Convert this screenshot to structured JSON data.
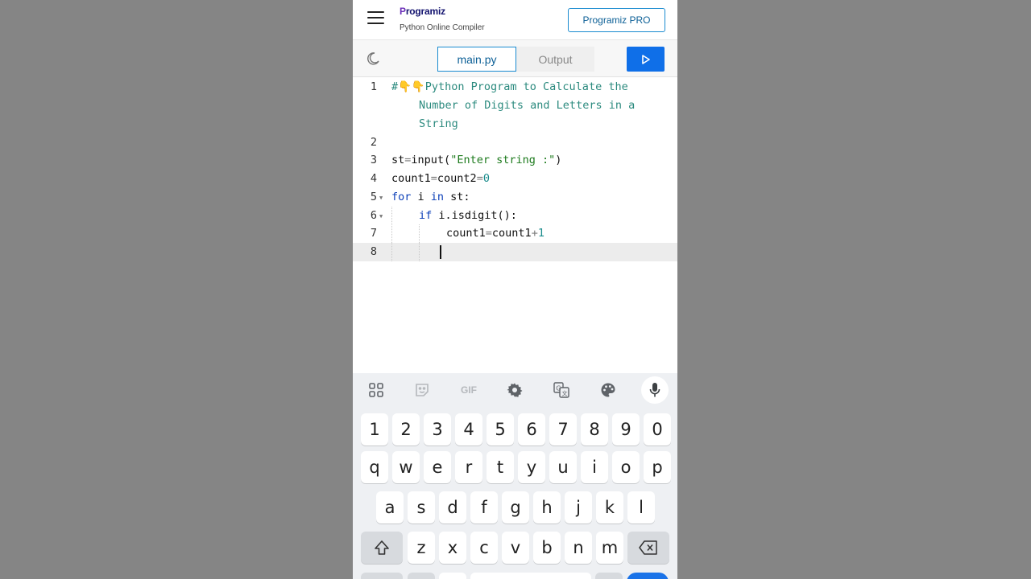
{
  "header": {
    "logo_text": "rogramiz",
    "logo_mark": "P",
    "subtitle": "Python Online Compiler",
    "pro_button": "Programiz PRO"
  },
  "toolbar": {
    "tab_main": "main.py",
    "tab_output": "Output",
    "theme_icon": "moon-icon",
    "run_icon": "play-icon"
  },
  "editor": {
    "line_numbers": [
      "1",
      "2",
      "3",
      "4",
      "5",
      "6",
      "7",
      "8"
    ],
    "comment_line1": "#👇👇Python Program to Calculate the",
    "comment_line2": "Number of Digits and Letters in a",
    "comment_line3": "String",
    "l3_var": "st",
    "l3_eq": "=",
    "l3_fn": "input(",
    "l3_str": "\"Enter string :\"",
    "l3_close": ")",
    "l4_a": "count1",
    "l4_eq1": "=",
    "l4_b": "count2",
    "l4_eq2": "=",
    "l4_num": "0",
    "l5_for": "for",
    "l5_i": " i ",
    "l5_in": "in",
    "l5_rest": " st:",
    "l6_if": "if",
    "l6_rest": " i.isdigit():",
    "l7_a": "count1",
    "l7_eq": "=",
    "l7_b": "count1",
    "l7_plus": "+",
    "l7_num": "1",
    "current_line": "8"
  },
  "keyboard": {
    "toolbar_icons": [
      "apps-grid-icon",
      "sticker-icon",
      "gif-icon",
      "settings-gear-icon",
      "translate-icon",
      "palette-icon",
      "microphone-icon"
    ],
    "gif_label": "GIF",
    "row_numbers": [
      "1",
      "2",
      "3",
      "4",
      "5",
      "6",
      "7",
      "8",
      "9",
      "0"
    ],
    "row1": [
      "q",
      "w",
      "e",
      "r",
      "t",
      "y",
      "u",
      "i",
      "o",
      "p"
    ],
    "row2": [
      "a",
      "s",
      "d",
      "f",
      "g",
      "h",
      "j",
      "k",
      "l"
    ],
    "row3": [
      "z",
      "x",
      "c",
      "v",
      "b",
      "n",
      "m"
    ],
    "shift_icon": "shift-arrow-icon",
    "backspace_icon": "backspace-icon"
  },
  "colors": {
    "accent_blue": "#0f6fe8",
    "comment_teal": "#2b8a7e",
    "keyword_blue": "#0b3fb8",
    "string_green": "#1c7a1c",
    "backdrop_gray": "#858585"
  }
}
